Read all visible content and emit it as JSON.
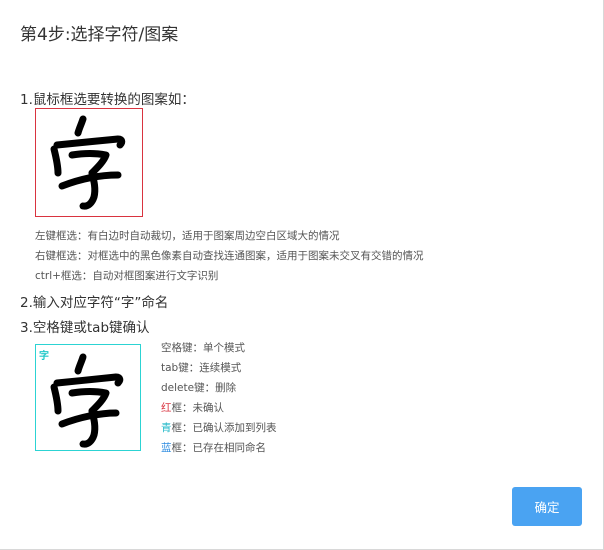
{
  "dialog": {
    "title": "第4步:选择字符/图案",
    "step1": "1.鼠标框选要转换的图案如：",
    "hints": {
      "left_drag": "左键框选：有白边时自动裁切，适用于图案周边空白区域大的情况",
      "right_drag": "右键框选：对框选中的黑色像素自动查找连通图案，适用于图案未交叉有交错的情况",
      "ctrl_drag": "ctrl+框选：自动对框图案进行文字识别"
    },
    "step2": "2.输入对应字符“字”命名",
    "step3": "3.空格键或tab键确认",
    "sample_tag": "字",
    "legend": {
      "space": "空格键：单个模式",
      "tab": "tab键：连续模式",
      "delete": "delete键：删除",
      "red_word": "红",
      "red_rest": "框：未确认",
      "cyan_word": "青",
      "cyan_rest": "框：已确认添加到列表",
      "blue_word": "蓝",
      "blue_rest": "框：已存在相同命名"
    },
    "ok_label": "确定"
  },
  "colors": {
    "red_frame": "#d9333f",
    "cyan_frame": "#2cd3d3",
    "blue_text": "#2e8ce0",
    "button_bg": "#4aa3f2"
  }
}
